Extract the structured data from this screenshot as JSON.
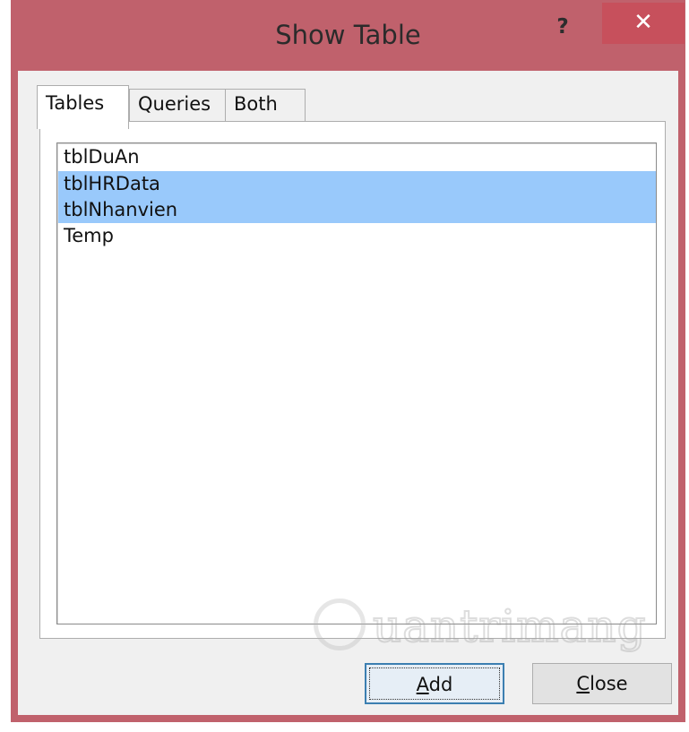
{
  "dialog": {
    "title": "Show Table",
    "help_label": "?",
    "close_label": "✕"
  },
  "tabs": [
    {
      "label": "Tables",
      "active": true
    },
    {
      "label": "Queries",
      "active": false
    },
    {
      "label": "Both",
      "active": false
    }
  ],
  "list": {
    "items": [
      {
        "label": "tblDuAn",
        "selected": false
      },
      {
        "label": "tblHRData",
        "selected": true
      },
      {
        "label": "tblNhanvien",
        "selected": true
      },
      {
        "label": "Temp",
        "selected": false
      }
    ]
  },
  "buttons": {
    "add_first": "A",
    "add_rest": "dd",
    "close_first": "C",
    "close_rest": "lose"
  },
  "watermark": {
    "text": "uantrimang"
  },
  "colors": {
    "titlebar": "#c0616c",
    "close_button": "#c7505c",
    "selection": "#99c9fb"
  }
}
